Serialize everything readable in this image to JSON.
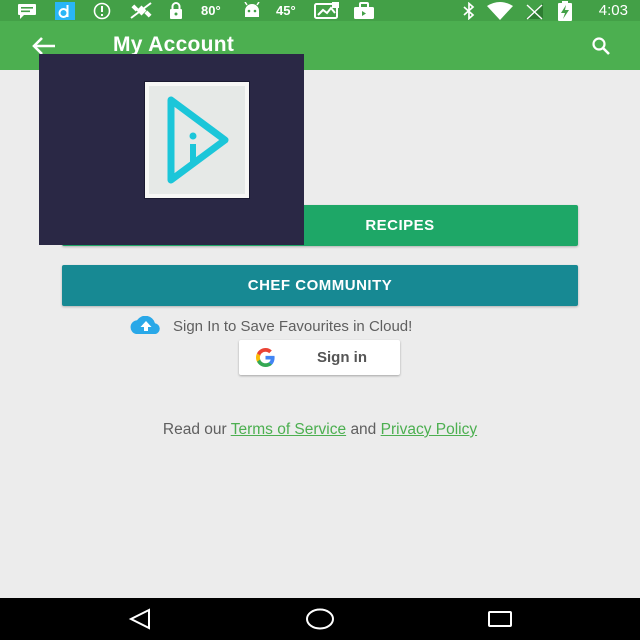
{
  "status_bar": {
    "temp_1": "80°",
    "temp_2": "45°",
    "time": "4:03",
    "icons": [
      "message-icon",
      "d-app-icon",
      "info-icon",
      "no-satellite-icon",
      "lock-icon",
      "thermometer-icon",
      "android-icon",
      "photo-icon",
      "briefcase-icon",
      "bluetooth-icon",
      "wifi-icon",
      "no-signal-icon",
      "battery-charging-icon"
    ]
  },
  "app_bar": {
    "title": "My Account",
    "back_icon": "arrow-left-icon",
    "search_icon": "search-icon",
    "color": "#4caf50"
  },
  "buttons": {
    "recipes_label": "RECIPES",
    "chef_label": "CHEF COMMUNITY",
    "recipes_color": "#1ea767",
    "chef_color": "#178993"
  },
  "cloud": {
    "icon": "cloud-upload-icon",
    "text": "Sign In to Save Favourites in Cloud!"
  },
  "google_signin": {
    "icon": "google-g-icon",
    "label": "Sign in"
  },
  "terms": {
    "prefix": "Read our",
    "terms_link": "Terms of Service",
    "conjunction": "and",
    "privacy_link": "Privacy Policy",
    "link_color": "#4caf50"
  },
  "nav_bar": {
    "back": "nav-back-icon",
    "home": "nav-home-icon",
    "recents": "nav-recents-icon"
  }
}
